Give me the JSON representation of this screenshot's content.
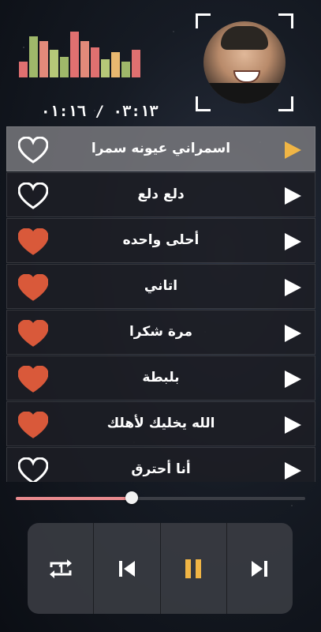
{
  "player": {
    "time_display": "٠٣:١٣ / ٠١:١٦",
    "progress": 0.4,
    "accent_color": "#e88a8e"
  },
  "equalizer": {
    "levels": [
      0.35,
      0.9,
      0.8,
      0.6,
      0.45,
      1.0,
      0.8,
      0.65,
      0.4,
      0.55,
      0.35,
      0.6
    ],
    "colors": [
      "#e07070",
      "#9fb86a",
      "#e28a7a",
      "#b6c878",
      "#9fb86a",
      "#e07070",
      "#e28a7a",
      "#e07070",
      "#b6c878",
      "#e8b870",
      "#9fb86a",
      "#e07070"
    ]
  },
  "playlist": {
    "songs": [
      {
        "title": "اسمراني عيونه سمرا",
        "favorite": false,
        "active": true
      },
      {
        "title": "دلع دلع",
        "favorite": false,
        "active": false
      },
      {
        "title": "أحلى واحده",
        "favorite": true,
        "active": false
      },
      {
        "title": "اتاني",
        "favorite": true,
        "active": false
      },
      {
        "title": "مرة شكرا",
        "favorite": true,
        "active": false
      },
      {
        "title": "بلبطة",
        "favorite": true,
        "active": false
      },
      {
        "title": "الله يخليك لأهلك",
        "favorite": true,
        "active": false
      },
      {
        "title": "أنا أحترق",
        "favorite": false,
        "active": false
      }
    ],
    "heart_color": "#d9593a",
    "active_play_color": "#f0b545"
  },
  "controls": {
    "icons": [
      "repeat-one-icon",
      "previous-icon",
      "pause-icon",
      "next-icon"
    ],
    "pause_color": "#f0b545"
  }
}
